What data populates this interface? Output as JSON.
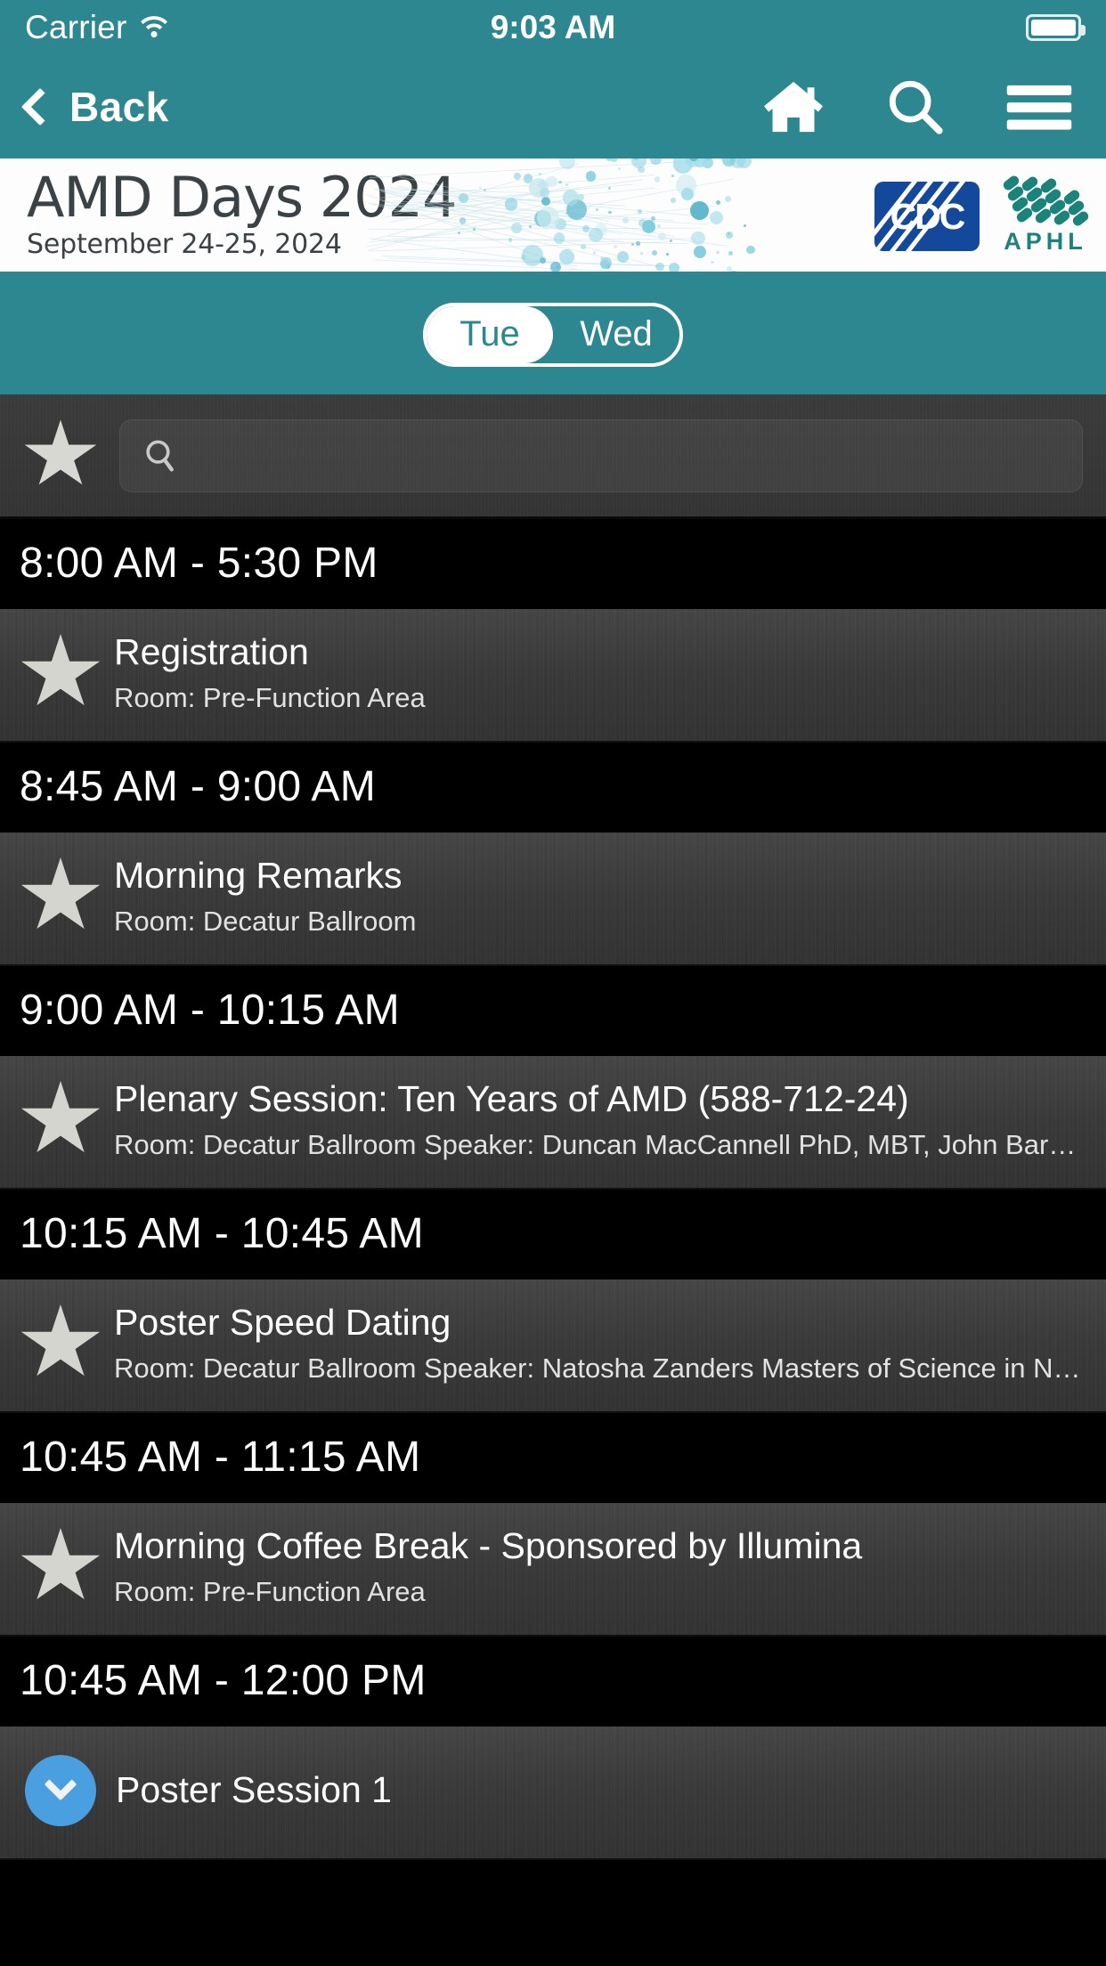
{
  "status_bar": {
    "carrier": "Carrier",
    "wifi_icon": "wifi-icon",
    "time": "9:03 AM",
    "battery_icon": "battery-icon"
  },
  "nav_bar": {
    "back_label": "Back",
    "back_icon": "chevron-left-icon",
    "home_icon": "home-icon",
    "search_icon": "search-icon",
    "menu_icon": "hamburger-menu-icon"
  },
  "banner": {
    "title": "AMD Days 2024",
    "subtitle": "September 24-25, 2024",
    "cdc_logo_text": "CDC",
    "aphl_logo_text": "APHL"
  },
  "day_selector": {
    "options": [
      {
        "label": "Tue",
        "selected": true
      },
      {
        "label": "Wed",
        "selected": false
      }
    ]
  },
  "filter_bar": {
    "favorites_icon": "star-icon",
    "search_icon": "search-icon",
    "search_value": "",
    "search_placeholder": ""
  },
  "schedule": [
    {
      "time": "8:00 AM - 5:30 PM",
      "sessions": [
        {
          "icon": "star-icon",
          "title": "Registration",
          "meta": "Room: Pre-Function Area"
        }
      ]
    },
    {
      "time": "8:45 AM - 9:00 AM",
      "sessions": [
        {
          "icon": "star-icon",
          "title": "Morning Remarks",
          "meta": "Room: Decatur Ballroom"
        }
      ]
    },
    {
      "time": "9:00 AM - 10:15 AM",
      "sessions": [
        {
          "icon": "star-icon",
          "title": "Plenary Session: Ten Years of AMD (588-712-24)",
          "meta": "Room: Decatur Ballroom Speaker: Duncan MacCannell PhD, MBT, John Barnes PhD,..."
        }
      ]
    },
    {
      "time": "10:15 AM - 10:45 AM",
      "sessions": [
        {
          "icon": "star-icon",
          "title": "Poster Speed Dating",
          "meta": "Room: Decatur Ballroom Speaker: Natosha Zanders Masters of Science in Natural R..."
        }
      ]
    },
    {
      "time": "10:45 AM - 11:15 AM",
      "sessions": [
        {
          "icon": "star-icon",
          "title": "Morning Coffee Break - Sponsored by Illumina",
          "meta": "Room: Pre-Function Area"
        }
      ]
    },
    {
      "time": "10:45 AM - 12:00 PM",
      "sessions": [
        {
          "icon": "chevron-down-circle-icon",
          "title": "Poster Session 1",
          "meta": ""
        }
      ]
    }
  ],
  "colors": {
    "teal": "#2C8791",
    "cdc_blue": "#14489B",
    "aphl_green": "#1B8379",
    "chevron_blue": "#4A9FE0",
    "row_gray": "#3A3A3A",
    "time_header_bg": "#000000"
  }
}
